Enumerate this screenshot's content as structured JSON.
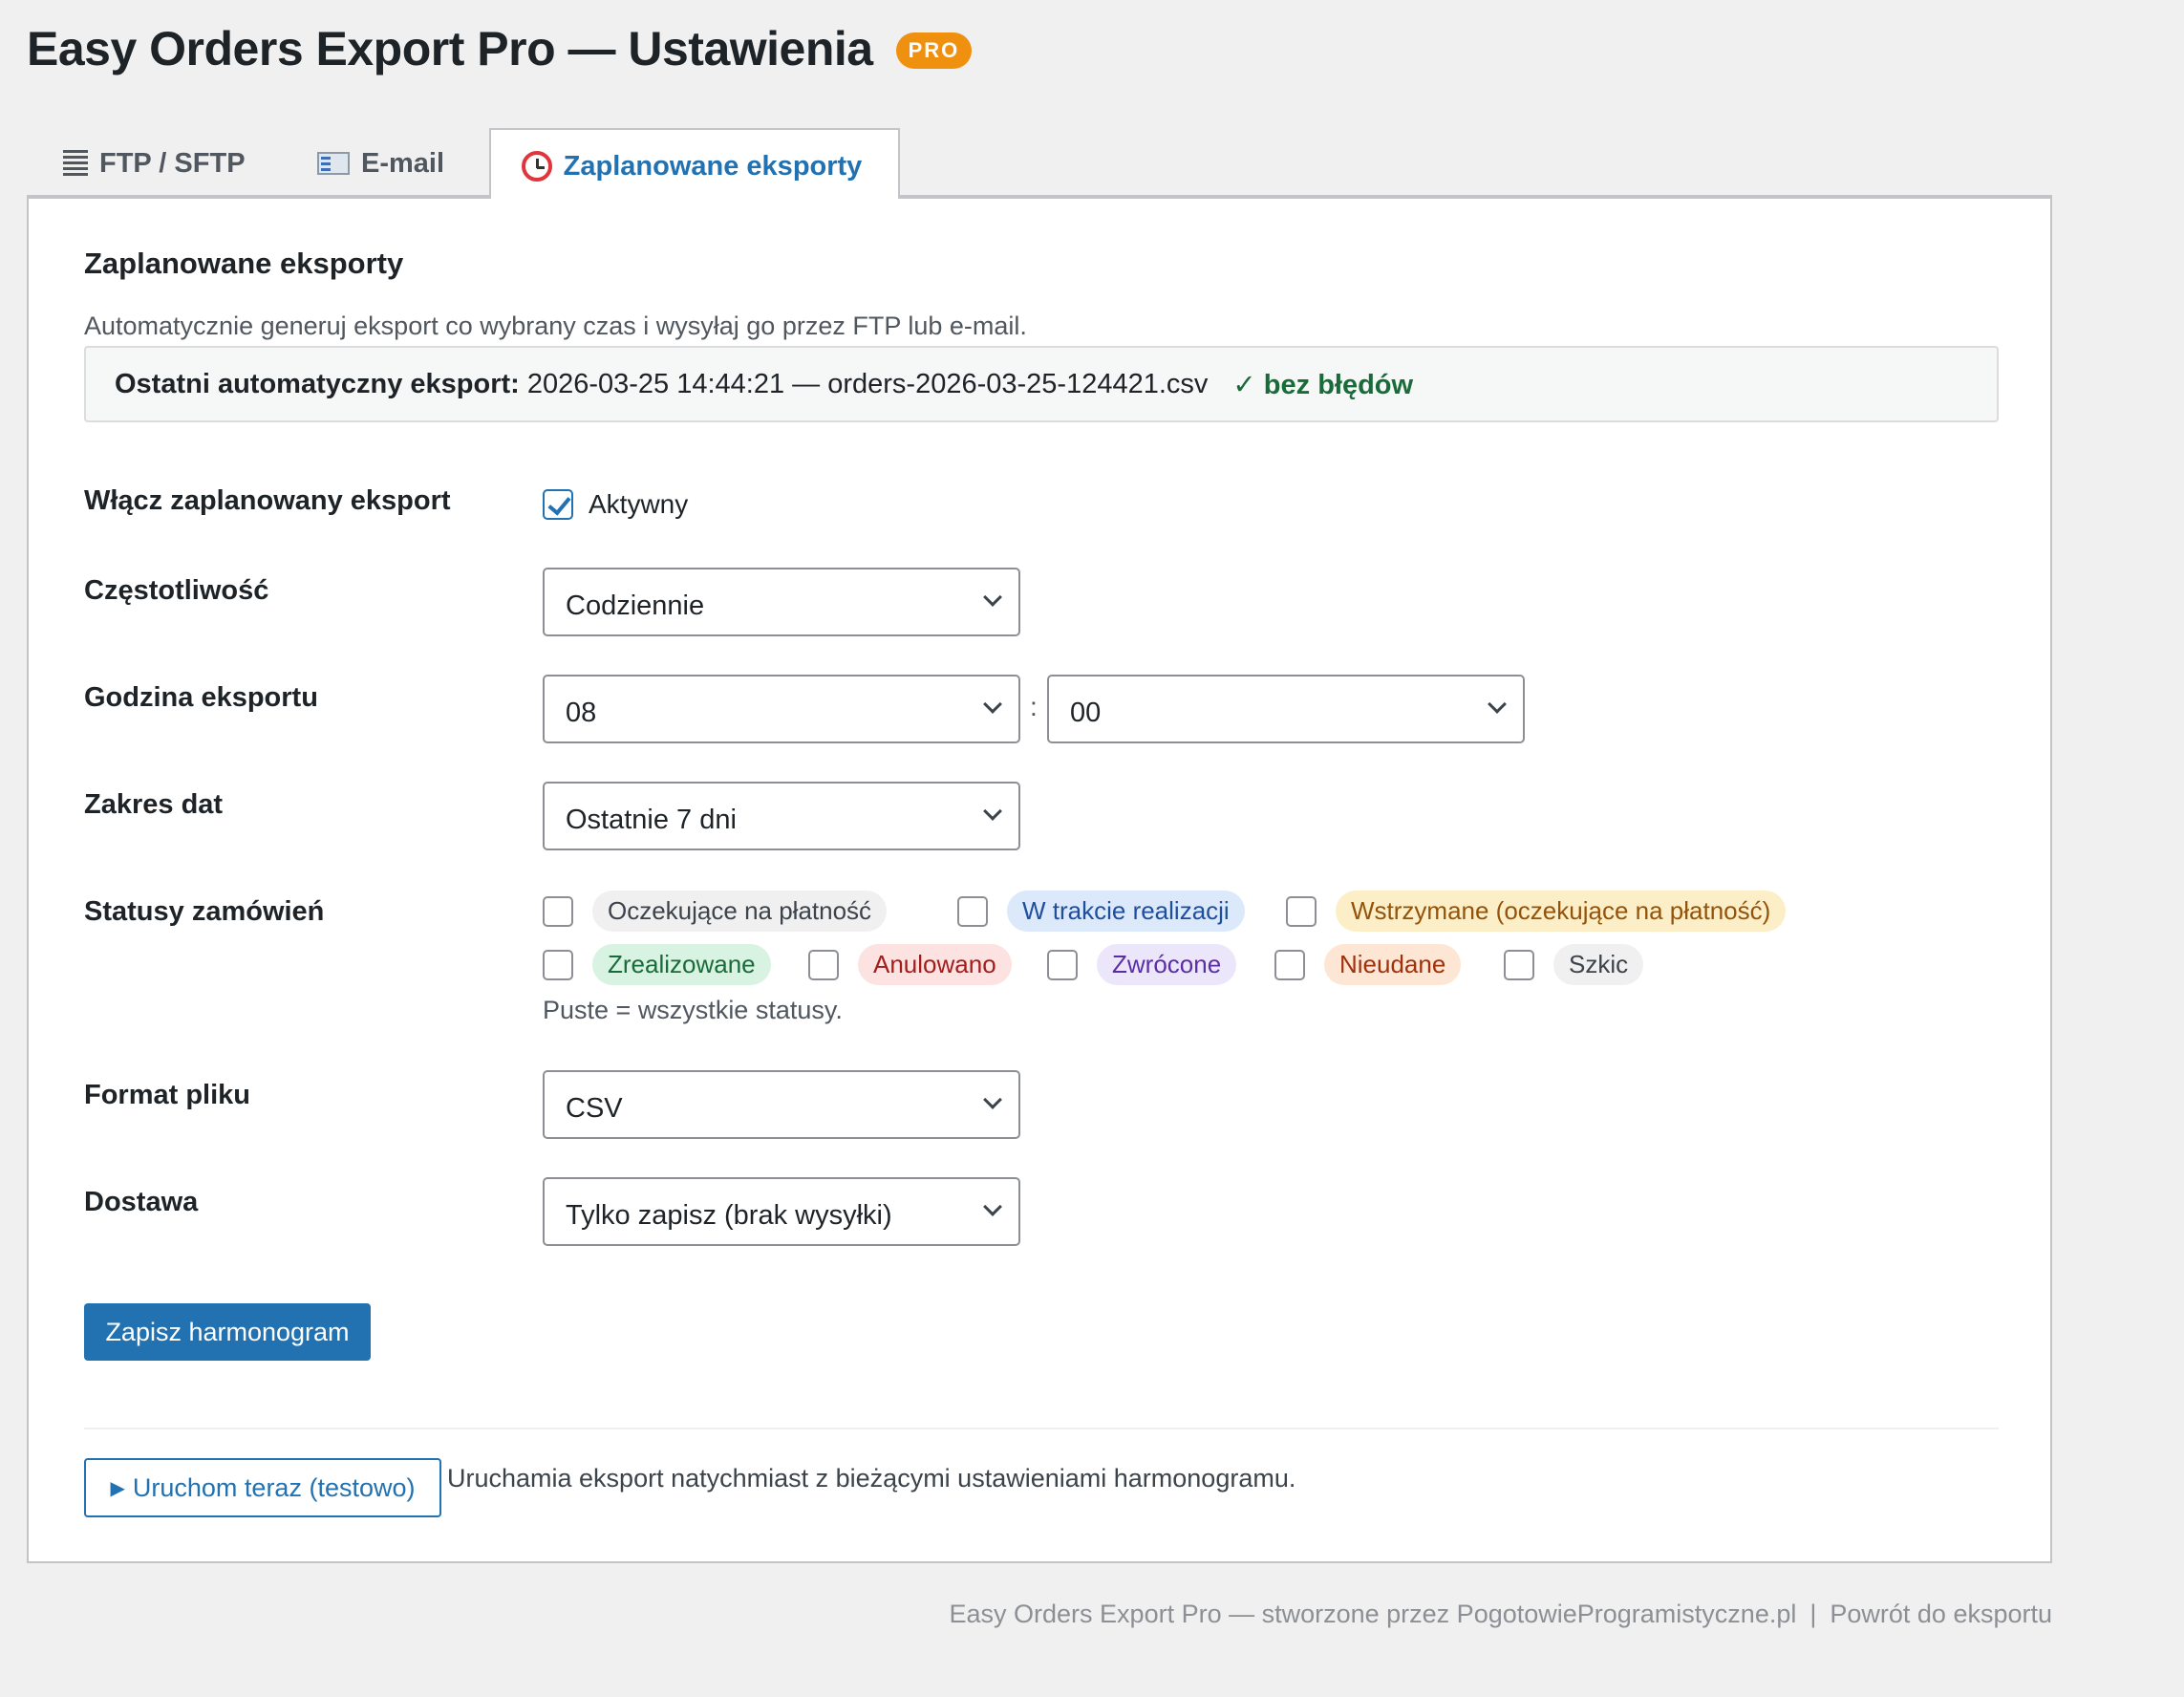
{
  "header": {
    "title": "Easy Orders Export Pro — Ustawienia",
    "badge": "PRO"
  },
  "tabs": [
    {
      "label": "FTP / SFTP",
      "icon": "list-icon",
      "active": false
    },
    {
      "label": "E-mail",
      "icon": "mail-icon",
      "active": false
    },
    {
      "label": "Zaplanowane eksporty",
      "icon": "alarm-clock-icon",
      "active": true
    }
  ],
  "section": {
    "title": "Zaplanowane eksporty",
    "description": "Automatycznie generuj eksport co wybrany czas i wysyłaj go przez FTP lub e-mail."
  },
  "last_export": {
    "label": "Ostatni automatyczny eksport:",
    "value": "2026-03-25 14:44:21 — orders-2026-03-25-124421.csv",
    "status_mark": "✓",
    "status": "bez błędów",
    "status_color": "#1a6b3a"
  },
  "form": {
    "enable": {
      "label": "Włącz zaplanowany eksport",
      "checkbox_label": "Aktywny",
      "checked": true
    },
    "frequency": {
      "label": "Częstotliwość",
      "value": "Codziennie"
    },
    "time": {
      "label": "Godzina eksportu",
      "hour": "08",
      "separator": ":",
      "minute": "00"
    },
    "date_range": {
      "label": "Zakres dat",
      "value": "Ostatnie 7 dni"
    },
    "statuses": {
      "label": "Statusy zamówień",
      "items": [
        {
          "label": "Oczekujące na płatność",
          "checked": false,
          "bg": "#f0f0f1",
          "fg": "#3c434a"
        },
        {
          "label": "W trakcie realizacji",
          "checked": false,
          "bg": "#dbe9fb",
          "fg": "#1f4e9c"
        },
        {
          "label": "Wstrzymane (oczekujące na płatność)",
          "checked": false,
          "bg": "#fcefc7",
          "fg": "#94530b"
        },
        {
          "label": "Zrealizowane",
          "checked": false,
          "bg": "#d8f3e2",
          "fg": "#1a6b3a"
        },
        {
          "label": "Anulowano",
          "checked": false,
          "bg": "#fde2e2",
          "fg": "#a41d1d"
        },
        {
          "label": "Zwrócone",
          "checked": false,
          "bg": "#ece6fb",
          "fg": "#5b2ea6"
        },
        {
          "label": "Nieudane",
          "checked": false,
          "bg": "#fde7d4",
          "fg": "#a1310c"
        },
        {
          "label": "Szkic",
          "checked": false,
          "bg": "#f0f0f1",
          "fg": "#3c434a"
        }
      ],
      "hint": "Puste = wszystkie statusy."
    },
    "format": {
      "label": "Format pliku",
      "value": "CSV"
    },
    "delivery": {
      "label": "Dostawa",
      "value": "Tylko zapisz (brak wysyłki)"
    }
  },
  "actions": {
    "save": "Zapisz harmonogram",
    "run_icon": "▶",
    "run": "Uruchom teraz (testowo)",
    "run_desc": "Uruchamia eksport natychmiast z bieżącymi ustawieniami harmonogramu."
  },
  "footer": {
    "credit": "Easy Orders Export Pro — stworzone przez PogotowieProgramistyczne.pl",
    "separator": "|",
    "back_link": "Powrót do eksportu"
  },
  "colors": {
    "accent": "#2271b1",
    "badge": "#f0900f"
  }
}
